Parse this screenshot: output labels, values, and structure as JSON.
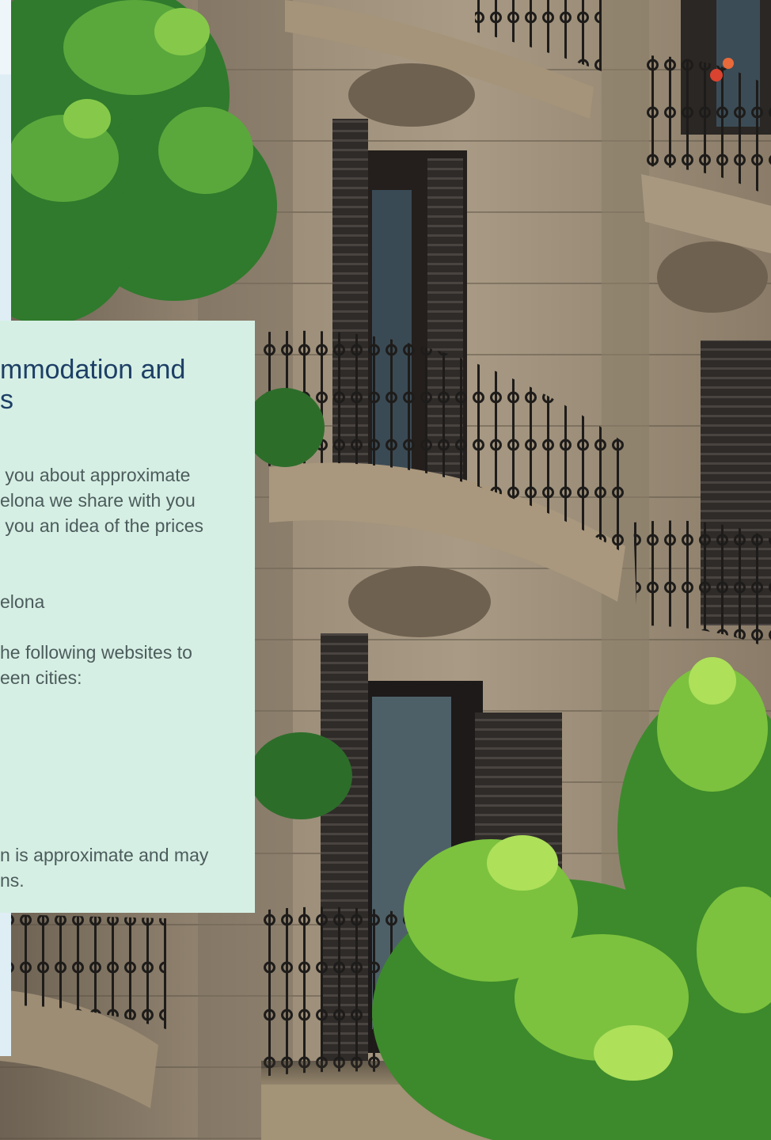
{
  "card": {
    "title": "mmodation and\ns",
    "paragraph_1": " you about approximate\nelona we share with you\n you an idea of the prices",
    "paragraph_2": "elona",
    "paragraph_3": "he following websites to\neen cities:",
    "note": "n is approximate and may\nns."
  },
  "colors": {
    "card_background": "#d6efe4",
    "title_color": "#1d3f66",
    "body_text_color": "#4c5c5c",
    "left_strip": "#dfeef5"
  }
}
